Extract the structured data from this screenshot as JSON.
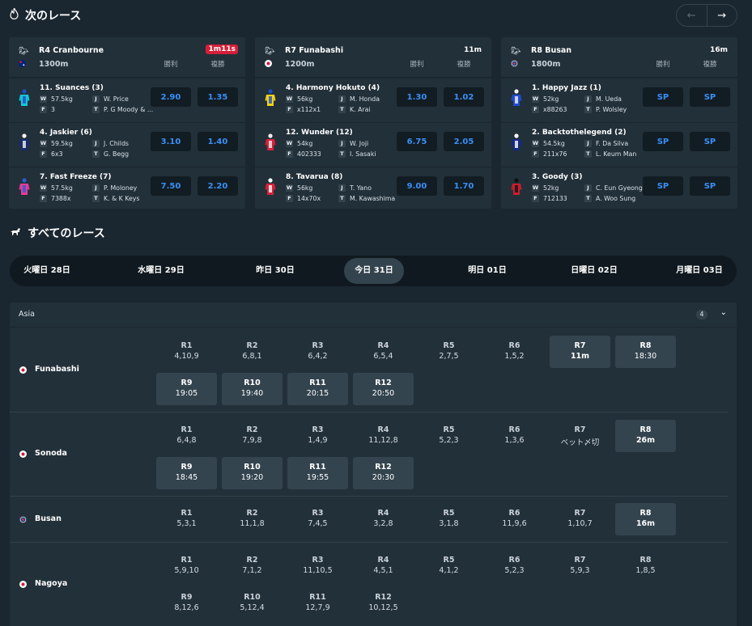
{
  "next_races": {
    "title": "次のレース",
    "col_win": "勝利",
    "col_place": "複勝",
    "cards": [
      {
        "name": "R4 Cranbourne",
        "distance": "1300m",
        "time": "1m11s",
        "flag": "au",
        "urgent": true,
        "runners": [
          {
            "name": "11. Suances",
            "draw": "(3)",
            "w": "57.5kg",
            "j": "W. Price",
            "f": "3",
            "t": "P. G Moody & ...",
            "win": "2.90",
            "place": "1.35",
            "silk": "cyan-blue"
          },
          {
            "name": "4. Jaskier",
            "draw": "(6)",
            "w": "59.5kg",
            "j": "J. Childs",
            "f": "6x3",
            "t": "G. Begg",
            "win": "3.10",
            "place": "1.40",
            "silk": "navy"
          },
          {
            "name": "7. Fast Freeze",
            "draw": "(7)",
            "w": "57.5kg",
            "j": "P. Moloney",
            "f": "7388x",
            "t": "K. & K Keys",
            "win": "7.50",
            "place": "2.20",
            "silk": "pink"
          }
        ]
      },
      {
        "name": "R7 Funabashi",
        "distance": "1200m",
        "time": "11m",
        "flag": "jp",
        "urgent": false,
        "runners": [
          {
            "name": "4. Harmony Hokuto",
            "draw": "(4)",
            "w": "56kg",
            "j": "M. Honda",
            "f": "x112x1",
            "t": "K. Arai",
            "win": "1.30",
            "place": "1.02",
            "silk": "yellow"
          },
          {
            "name": "12. Wunder",
            "draw": "(12)",
            "w": "54kg",
            "j": "W. Joji",
            "f": "402333",
            "t": "I. Sasaki",
            "win": "6.75",
            "place": "2.05",
            "silk": "red"
          },
          {
            "name": "8. Tavarua",
            "draw": "(8)",
            "w": "56kg",
            "j": "T. Yano",
            "f": "14x70x",
            "t": "M. Kawashima",
            "win": "9.00",
            "place": "1.70",
            "silk": "red-white"
          }
        ]
      },
      {
        "name": "R8 Busan",
        "distance": "1800m",
        "time": "16m",
        "flag": "kr",
        "urgent": false,
        "runners": [
          {
            "name": "1. Happy Jazz",
            "draw": "(1)",
            "w": "52kg",
            "j": "M. Ueda",
            "f": "x88263",
            "t": "P. Wolsley",
            "win": "SP",
            "place": "SP",
            "silk": "blue-white"
          },
          {
            "name": "2. Backtothelegend",
            "draw": "(2)",
            "w": "54.5kg",
            "j": "F. Da Silva",
            "f": "211x76",
            "t": "L. Keum Man",
            "win": "SP",
            "place": "SP",
            "silk": "navy-white"
          },
          {
            "name": "3. Goody",
            "draw": "(3)",
            "w": "52kg",
            "j": "C. Eun Gyeong",
            "f": "712133",
            "t": "A. Woo Sung",
            "win": "SP",
            "place": "SP",
            "silk": "red-black"
          }
        ]
      }
    ]
  },
  "all_races": {
    "title": "すべてのレース",
    "dates": [
      "火曜日 28日",
      "水曜日 29日",
      "昨日 30日",
      "今日 31日",
      "明日 01日",
      "日曜日 02日",
      "月曜日 03日"
    ],
    "active_date": 3,
    "region": {
      "name": "Asia",
      "count": "4"
    },
    "venues": [
      {
        "name": "Funabashi",
        "flag": "jp",
        "races": [
          {
            "r": "R1",
            "v": "4,10,9"
          },
          {
            "r": "R2",
            "v": "6,8,1"
          },
          {
            "r": "R3",
            "v": "6,4,2"
          },
          {
            "r": "R4",
            "v": "6,5,4"
          },
          {
            "r": "R5",
            "v": "2,7,5"
          },
          {
            "r": "R6",
            "v": "1,5,2"
          },
          {
            "r": "R7",
            "v": "11m",
            "btn": true
          },
          {
            "r": "R8",
            "v": "18:30",
            "btn": true
          },
          {
            "r": "R9",
            "v": "19:05",
            "btn": true
          },
          {
            "r": "R10",
            "v": "19:40",
            "btn": true
          },
          {
            "r": "R11",
            "v": "20:15",
            "btn": true
          },
          {
            "r": "R12",
            "v": "20:50",
            "btn": true
          }
        ]
      },
      {
        "name": "Sonoda",
        "flag": "jp",
        "races": [
          {
            "r": "R1",
            "v": "6,4,8"
          },
          {
            "r": "R2",
            "v": "7,9,8"
          },
          {
            "r": "R3",
            "v": "1,4,9"
          },
          {
            "r": "R4",
            "v": "11,12,8"
          },
          {
            "r": "R5",
            "v": "5,2,3"
          },
          {
            "r": "R6",
            "v": "1,3,6"
          },
          {
            "r": "R7",
            "v": "ベット〆切"
          },
          {
            "r": "R8",
            "v": "26m",
            "btn": true
          },
          {
            "r": "R9",
            "v": "18:45",
            "btn": true
          },
          {
            "r": "R10",
            "v": "19:20",
            "btn": true
          },
          {
            "r": "R11",
            "v": "19:55",
            "btn": true
          },
          {
            "r": "R12",
            "v": "20:30",
            "btn": true
          }
        ]
      },
      {
        "name": "Busan",
        "flag": "kr",
        "races": [
          {
            "r": "R1",
            "v": "5,3,1"
          },
          {
            "r": "R2",
            "v": "11,1,8"
          },
          {
            "r": "R3",
            "v": "7,4,5"
          },
          {
            "r": "R4",
            "v": "3,2,8"
          },
          {
            "r": "R5",
            "v": "3,1,8"
          },
          {
            "r": "R6",
            "v": "11,9,6"
          },
          {
            "r": "R7",
            "v": "1,10,7"
          },
          {
            "r": "R8",
            "v": "16m",
            "btn": true
          }
        ]
      },
      {
        "name": "Nagoya",
        "flag": "jp",
        "races": [
          {
            "r": "R1",
            "v": "5,9,10"
          },
          {
            "r": "R2",
            "v": "7,1,2"
          },
          {
            "r": "R3",
            "v": "11,10,5"
          },
          {
            "r": "R4",
            "v": "4,5,1"
          },
          {
            "r": "R5",
            "v": "4,1,2"
          },
          {
            "r": "R6",
            "v": "5,2,3"
          },
          {
            "r": "R7",
            "v": "5,9,3"
          },
          {
            "r": "R8",
            "v": "1,8,5"
          },
          {
            "r": "R9",
            "v": "8,12,6"
          },
          {
            "r": "R10",
            "v": "5,12,4"
          },
          {
            "r": "R11",
            "v": "12,7,9"
          },
          {
            "r": "R12",
            "v": "10,12,5"
          }
        ]
      }
    ]
  },
  "icons": {
    "fire": "fire-icon",
    "horse": "horse-icon",
    "prev": "arrow-left-icon",
    "next": "arrow-right-icon",
    "chevron": "chevron-down-icon"
  },
  "colors": {
    "odds": "#3a8ff6",
    "urgent": "#d51f38",
    "background": "#1a2630",
    "card": "#223039"
  }
}
